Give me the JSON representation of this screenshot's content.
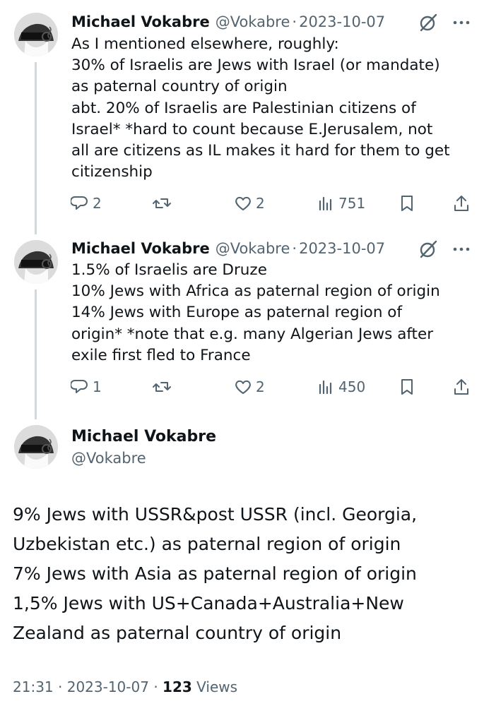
{
  "tweets": [
    {
      "author_name": "Michael Vokabre",
      "handle": "@Vokabre",
      "date": "2023-10-07",
      "lines": [
        "As I mentioned elsewhere, roughly:",
        "30% of Israelis are Jews with Israel (or mandate)",
        "as paternal country of origin",
        "abt. 20% of Israelis are Palestinian citizens of",
        "Israel* *hard to count because E.Jerusalem, not",
        "all are citizens as IL makes it hard for them to get",
        "citizenship"
      ],
      "replies": "2",
      "retweets": "",
      "likes": "2",
      "views": "751"
    },
    {
      "author_name": "Michael Vokabre",
      "handle": "@Vokabre",
      "date": "2023-10-07",
      "lines": [
        "1.5% of Israelis are Druze",
        "10% Jews with Africa as paternal region of origin",
        "14% Jews with Europe as paternal region of",
        "origin* *note that e.g. many Algerian Jews after",
        "exile first fled to France"
      ],
      "replies": "1",
      "retweets": "",
      "likes": "2",
      "views": "450"
    }
  ],
  "main": {
    "author_name": "Michael Vokabre",
    "handle": "@Vokabre",
    "lines": [
      "9% Jews with USSR&post USSR (incl. Georgia,",
      "Uzbekistan etc.) as paternal region of origin",
      "7% Jews with Asia as paternal region of origin",
      "1,5% Jews with US+Canada+Australia+New",
      "Zealand as paternal country of origin"
    ],
    "time": "21:31",
    "date": "2023-10-07",
    "views_count": "123",
    "views_label": "Views"
  },
  "icons": {
    "reply": "reply-icon",
    "retweet": "retweet-icon",
    "like": "like-icon",
    "views": "views-icon",
    "bookmark": "bookmark-icon",
    "share": "share-icon",
    "grok": "grok-icon",
    "more": "more-icon"
  },
  "colors": {
    "text": "#0f1419",
    "secondary": "#536471",
    "thread_line": "#cfd9de"
  }
}
